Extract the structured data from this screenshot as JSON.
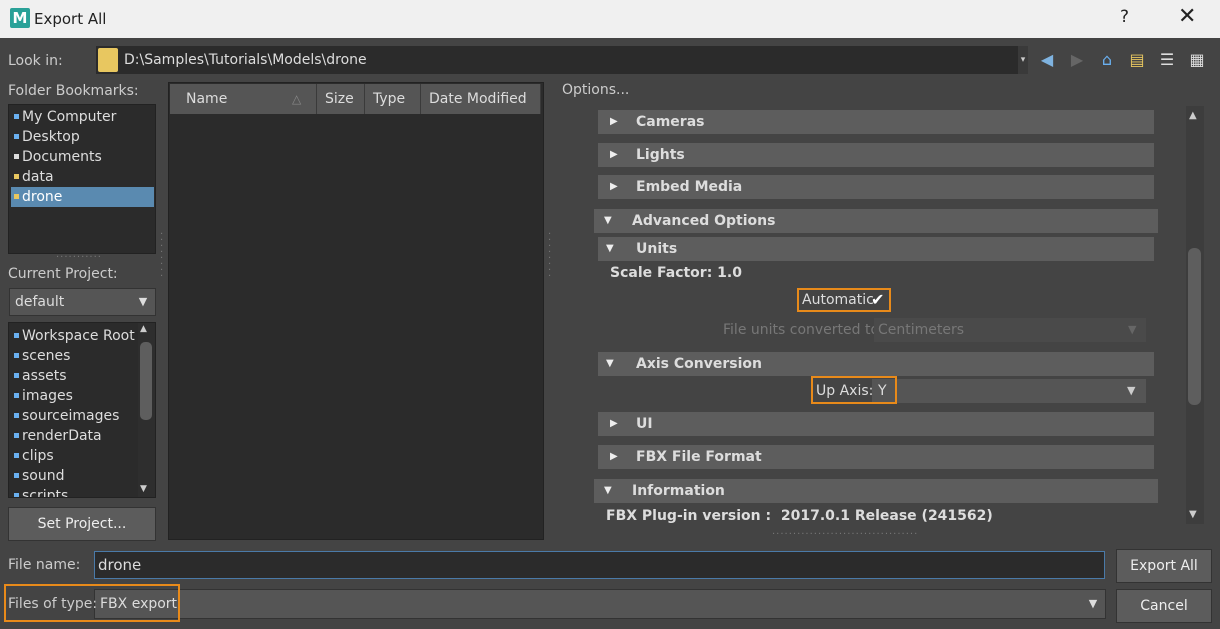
{
  "window": {
    "title": "Export All",
    "app_icon_letter": "M",
    "help_glyph": "?",
    "close_glyph": "✕"
  },
  "lookin": {
    "label": "Look in:",
    "path": "D:\\Samples\\Tutorials\\Models\\drone"
  },
  "toolbar_icons": [
    "back-icon",
    "forward-icon",
    "up-folder-icon",
    "new-folder-icon",
    "list-view-icon",
    "detail-view-icon"
  ],
  "bookmarks": {
    "label": "Folder Bookmarks:",
    "items": [
      "My Computer",
      "Desktop",
      "Documents",
      "data",
      "drone"
    ],
    "selected": "drone"
  },
  "current_project": {
    "label": "Current Project:",
    "value": "default"
  },
  "workspace": {
    "items": [
      "Workspace Root",
      "scenes",
      "assets",
      "images",
      "sourceimages",
      "renderData",
      "clips",
      "sound",
      "scripts"
    ]
  },
  "set_project_label": "Set Project...",
  "file_list": {
    "columns": [
      "Name",
      "Size",
      "Type",
      "Date Modified"
    ]
  },
  "options": {
    "label": "Options...",
    "cameras": "Cameras",
    "lights": "Lights",
    "embed_media": "Embed Media",
    "advanced_options": "Advanced Options",
    "units": "Units",
    "scale_factor": "Scale Factor: 1.0",
    "automatic_label": "Automatic",
    "automatic_checked": true,
    "file_units_label": "File units converted to:",
    "file_units_value": "Centimeters",
    "axis_conversion": "Axis Conversion",
    "up_axis_label": "Up Axis:",
    "up_axis_value": "Y",
    "ui": "UI",
    "fbx_file_format": "FBX File Format",
    "information": "Information",
    "plugin_version": "FBX Plug-in version :  2017.0.1 Release (241562)"
  },
  "file_name": {
    "label": "File name:",
    "value": "drone"
  },
  "file_type": {
    "label": "Files of type:",
    "value": "FBX export"
  },
  "buttons": {
    "export": "Export All",
    "cancel": "Cancel"
  },
  "colors": {
    "highlight": "#e88a1a",
    "selection": "#5a8ab0"
  }
}
